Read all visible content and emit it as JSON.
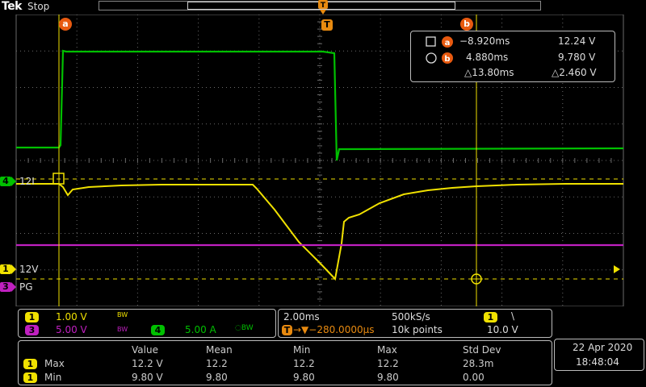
{
  "header": {
    "logo": "Tek",
    "run_state": "Stop"
  },
  "cursors": {
    "label_a": "a",
    "label_b": "b",
    "trigger_marker": "T",
    "readout": {
      "a_time": "−8.920ms",
      "a_value": "12.24 V",
      "b_time": "4.880ms",
      "b_value": "9.780 V",
      "delta_time": "△13.80ms",
      "delta_value": "△2.460 V"
    }
  },
  "channel_markers": {
    "ch4": {
      "num": "4",
      "label": "12I"
    },
    "ch1": {
      "num": "1",
      "label": "12V"
    },
    "ch3": {
      "num": "3",
      "label": "PG"
    }
  },
  "channels": [
    {
      "num": "1",
      "scale": "1.00 V",
      "bw": "BW",
      "color": "#f0e100"
    },
    {
      "num": "3",
      "scale": "5.00 V",
      "bw": "BW",
      "color": "#c020c0"
    },
    {
      "num": "4",
      "scale": "5.00 A",
      "bw": "BW",
      "color": "#00c000"
    }
  ],
  "timebase": {
    "horizontal_scale": "2.00ms",
    "sample_rate": "500kS/s",
    "position": "→▼−280.0000µs",
    "record_length": "10k points",
    "trigger_channel": "1",
    "trigger_slope": "\\",
    "trigger_level": "10.0 V"
  },
  "measurements": {
    "headers": [
      "Value",
      "Mean",
      "Min",
      "Max",
      "Std Dev"
    ],
    "rows": [
      {
        "ch": "1",
        "name": "Max",
        "values": [
          "12.2 V",
          "12.2",
          "12.2",
          "12.2",
          "28.3m"
        ]
      },
      {
        "ch": "1",
        "name": "Min",
        "values": [
          "9.80 V",
          "9.80",
          "9.80",
          "9.80",
          "0.00"
        ]
      }
    ]
  },
  "datetime": {
    "date": "22 Apr  2020",
    "time": "18:48:04"
  },
  "colors": {
    "ch1": "#f0e100",
    "ch3": "#c020c0",
    "ch4": "#00c000",
    "cursor_badge": "#e85a10",
    "grid": "#6a6a6a"
  }
}
